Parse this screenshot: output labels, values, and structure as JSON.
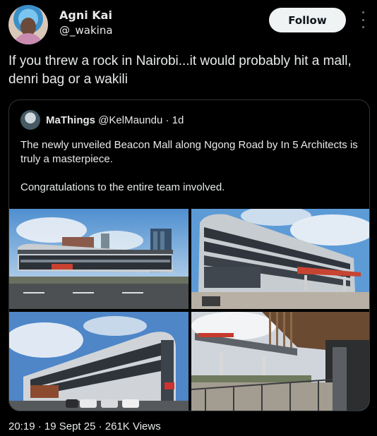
{
  "author": {
    "display_name": "Agni Kai",
    "handle": "@_wakina"
  },
  "actions": {
    "follow_label": "Follow",
    "more_icon": "more-vertical-icon"
  },
  "post": {
    "text": "If you threw a rock in Nairobi...it would probably hit a mall, denri bag or a wakili"
  },
  "quoted": {
    "name": "MaThings",
    "handle": "@KelMaundu",
    "time": "· 1d",
    "text": "The newly unveiled Beacon Mall along Ngong Road by In 5 Architects is truly a masterpiece.\n\nCongratulations to the entire team involved."
  },
  "footer": {
    "meta": "20:19 · 19 Sept 25 · 261K Views"
  }
}
